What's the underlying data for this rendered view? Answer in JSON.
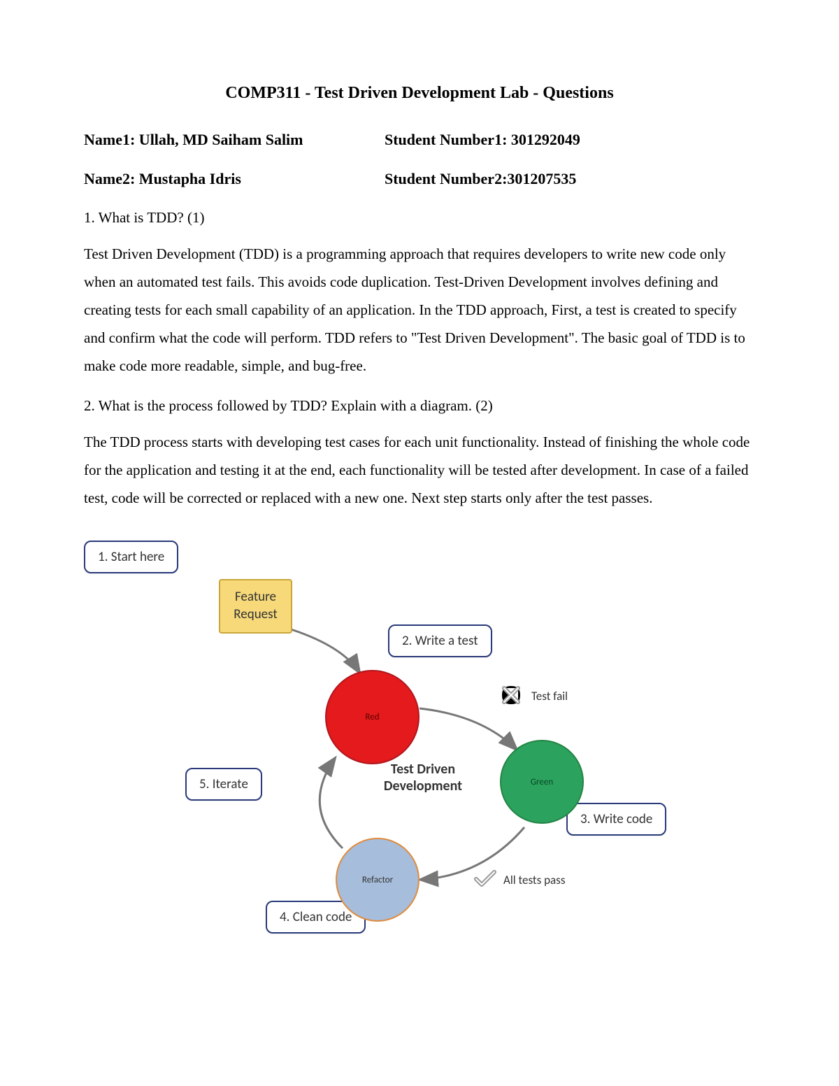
{
  "title": "COMP311 - Test Driven Development Lab - Questions",
  "student1": {
    "nameLabel": "Name1: Ullah, MD Saiham Salim",
    "numLabel": "Student Number1: 301292049"
  },
  "student2": {
    "nameLabel": "Name2: Mustapha Idris",
    "numLabel": "Student Number2:301207535"
  },
  "q1": {
    "question": "1. What is TDD? (1)",
    "answer": "Test Driven Development (TDD) is a programming approach that requires developers to write new code only when an automated test fails. This avoids code duplication. Test-Driven Development involves defining and creating tests for each small capability of an application. In the TDD approach, First, a test is created to specify and confirm what the code will perform. TDD refers to \"Test Driven Development\". The basic goal of TDD is to make code more readable, simple, and bug-free."
  },
  "q2": {
    "question": "2. What is the process followed by TDD? Explain with a diagram. (2)",
    "answer": "The TDD process starts with developing test cases for each unit functionality. Instead of finishing the whole code for the application and testing it at the end, each functionality will be tested after development. In case of a failed test, code will be corrected or replaced with a new one. Next step starts only after the test passes."
  },
  "diagram": {
    "step1": "1. Start here",
    "feature": "Feature Request",
    "step2": "2. Write a test",
    "step3": "3. Write code",
    "step4": "4. Clean code",
    "step5": "5. Iterate",
    "center1": "Test Driven",
    "center2": "Development",
    "red": "Red",
    "green": "Green",
    "refactor": "Refactor",
    "fail": "Test fail",
    "pass": "All tests pass"
  }
}
